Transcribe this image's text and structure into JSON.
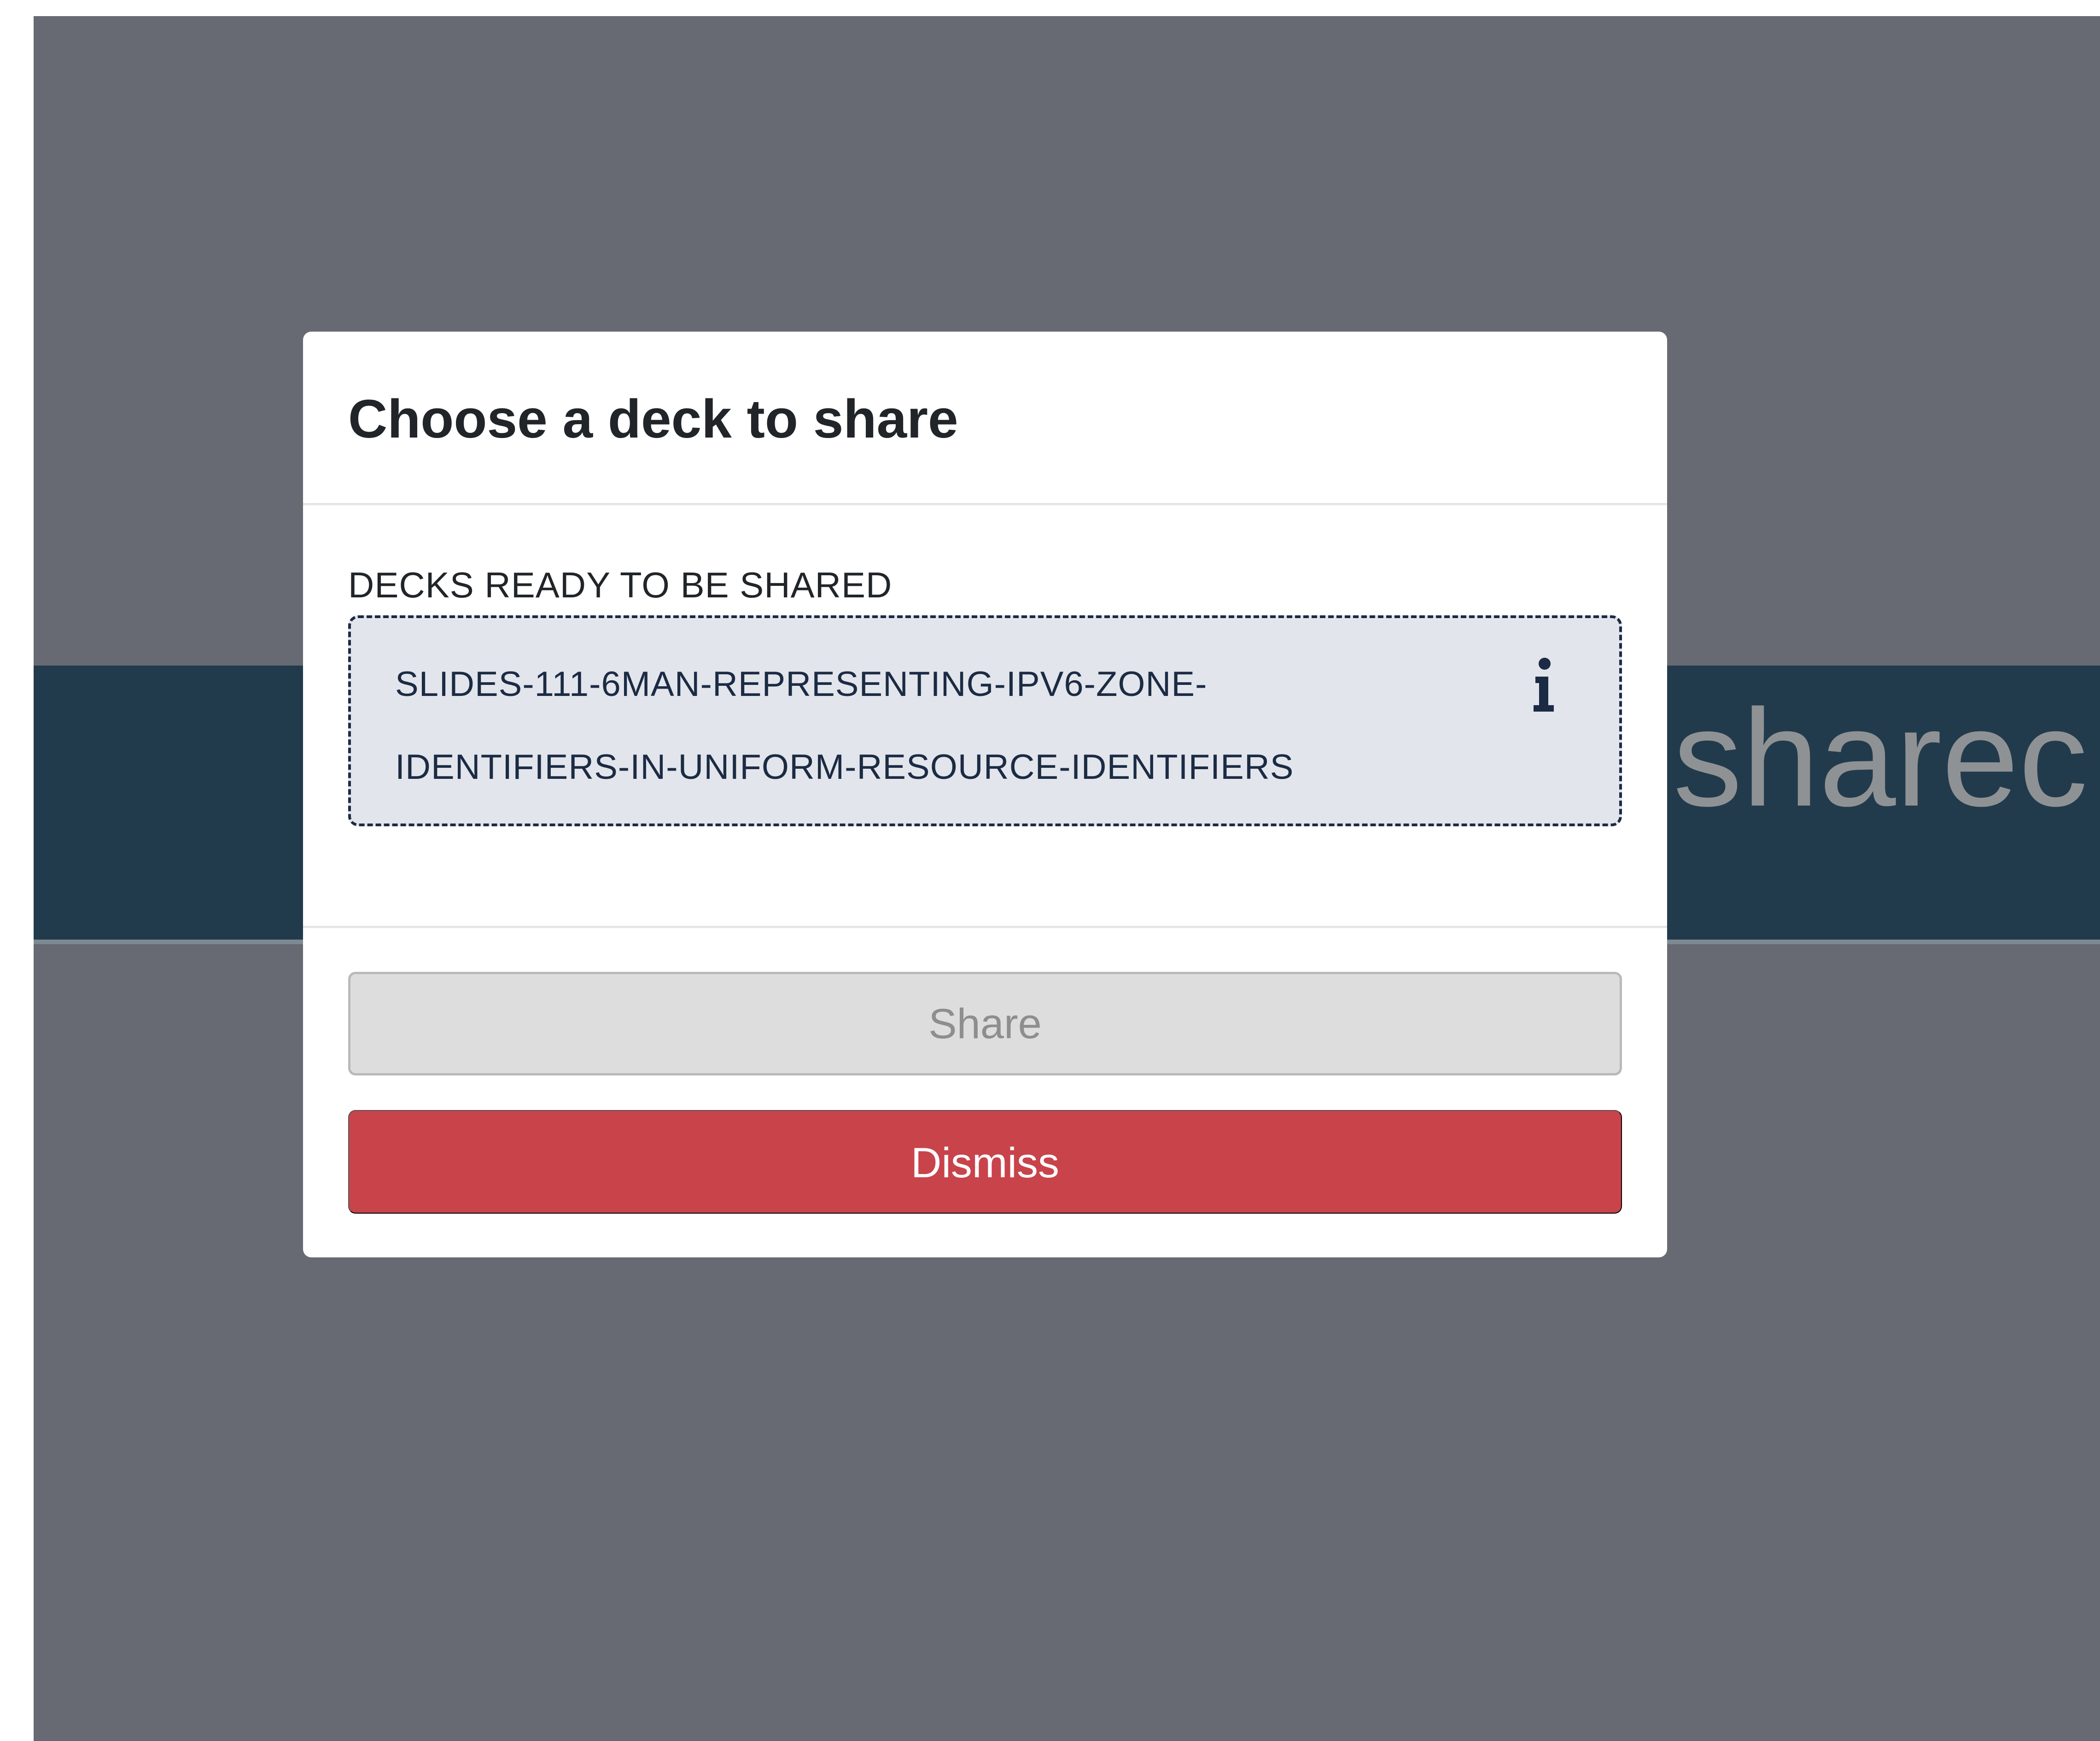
{
  "background": {
    "band_text": "sharec",
    "overlay_color": "#676a72",
    "band_color": "#223b4c"
  },
  "modal": {
    "title": "Choose a deck to share",
    "section_label": "DECKS READY TO BE SHARED",
    "deck": {
      "line1": "SLIDES-111-6MAN-REPRESENTING-IPV6-ZONE-",
      "line2": "IDENTIFIERS-IN-UNIFORM-RESOURCE-IDENTIFIERS",
      "icon": "info-icon"
    },
    "buttons": {
      "share_label": "Share",
      "dismiss_label": "Dismiss"
    },
    "colors": {
      "dismiss": "#c9434b",
      "share_disabled": "#dddddd",
      "deck_text": "#1c2b44"
    }
  }
}
